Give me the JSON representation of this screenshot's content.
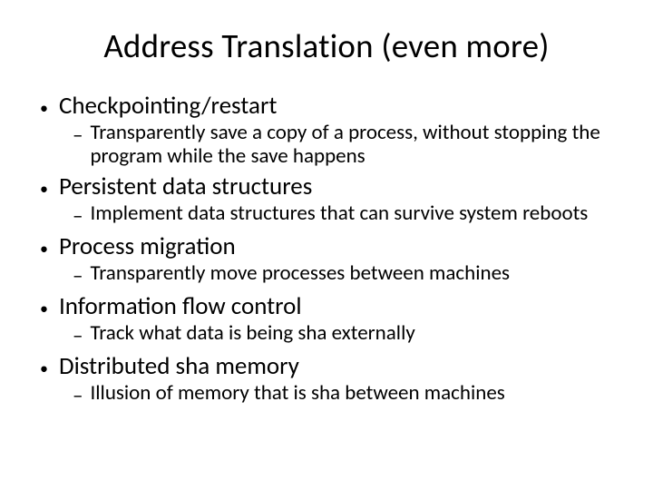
{
  "title": "Address Translation (even more)",
  "items": [
    {
      "label": "Checkpointing/restart",
      "sub": "Transparently save a copy of a process, without stopping the program while the save happens"
    },
    {
      "label": "Persistent data structures",
      "sub": "Implement data structures that can survive system reboots"
    },
    {
      "label": "Process migration",
      "sub": "Transparently move processes between machines"
    },
    {
      "label": "Information flow control",
      "sub": "Track what data is being sha externally"
    },
    {
      "label": "Distributed sha memory",
      "sub": "Illusion of memory that is sha between machines"
    }
  ]
}
